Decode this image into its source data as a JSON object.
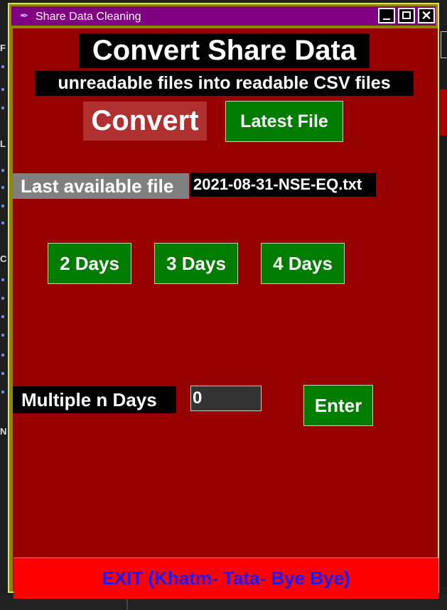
{
  "window": {
    "title": "Share Data Cleaning",
    "close_glyph": "✕"
  },
  "background": {
    "left_letters": [
      "F",
      "L",
      "C",
      "N"
    ]
  },
  "header": {
    "title": "Convert Share Data",
    "subtitle": "unreadable files into readable CSV files"
  },
  "actions": {
    "convert_label": "Convert",
    "latest_file_label": "Latest File"
  },
  "last_file": {
    "label": "Last available file",
    "value": "2021-08-31-NSE-EQ.txt"
  },
  "days_buttons": [
    "2 Days",
    "3 Days",
    "4 Days"
  ],
  "multiple": {
    "label": "Multiple n Days",
    "input_value": "0",
    "enter_label": "Enter"
  },
  "exit_label": "EXIT (Khatm- Tata- Bye Bye)",
  "colors": {
    "content_bg": "#960000",
    "title_bar": "#7f0080",
    "button_green": "#007c00",
    "exit_red": "#ff0000",
    "exit_text": "#1a1aff"
  }
}
